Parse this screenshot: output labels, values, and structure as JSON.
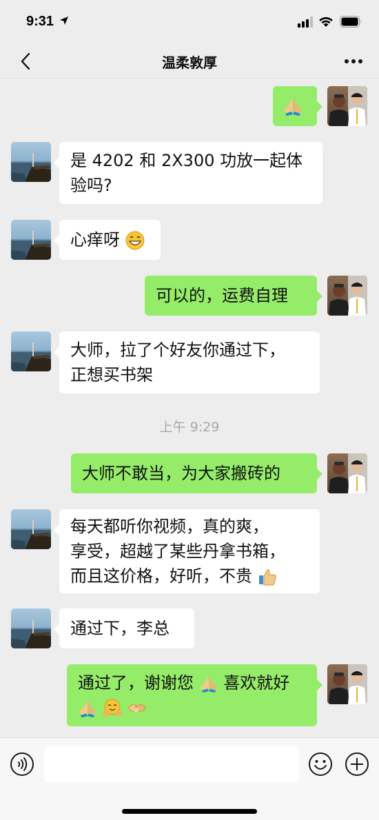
{
  "status_bar": {
    "time": "9:31"
  },
  "header": {
    "title": "温柔敦厚"
  },
  "colors": {
    "sent_bubble": "#95ec69",
    "received_bubble": "#ffffff",
    "background": "#ededed"
  },
  "messages": [
    {
      "side": "right",
      "text": "",
      "emojis": [
        "folded-hands"
      ]
    },
    {
      "side": "left",
      "lines": [
        "是 4202 和 2X300 功放一起体",
        "验吗?"
      ]
    },
    {
      "side": "left",
      "text": "心痒呀",
      "emojis": [
        "grinning-face"
      ]
    },
    {
      "side": "right",
      "text": "可以的，运费自理"
    },
    {
      "side": "left",
      "lines": [
        "大师，拉了个好友你通过下，",
        "正想买书架"
      ]
    },
    {
      "timestamp": "上午 9:29"
    },
    {
      "side": "right",
      "text": "大师不敢当，为大家搬砖的"
    },
    {
      "side": "left",
      "lines": [
        "每天都听你视频，真的爽，",
        "享受，超越了某些丹拿书箱，",
        "而且这价格，好听，不贵"
      ],
      "emojis": [
        "thumbs-up"
      ]
    },
    {
      "side": "left",
      "text": "通过下，李总"
    },
    {
      "side": "right",
      "lines": [
        "通过了，谢谢您",
        "喜欢就好"
      ],
      "emojis": [
        "folded-hands",
        "folded-hands",
        "hugging-face",
        "handshake"
      ]
    }
  ]
}
